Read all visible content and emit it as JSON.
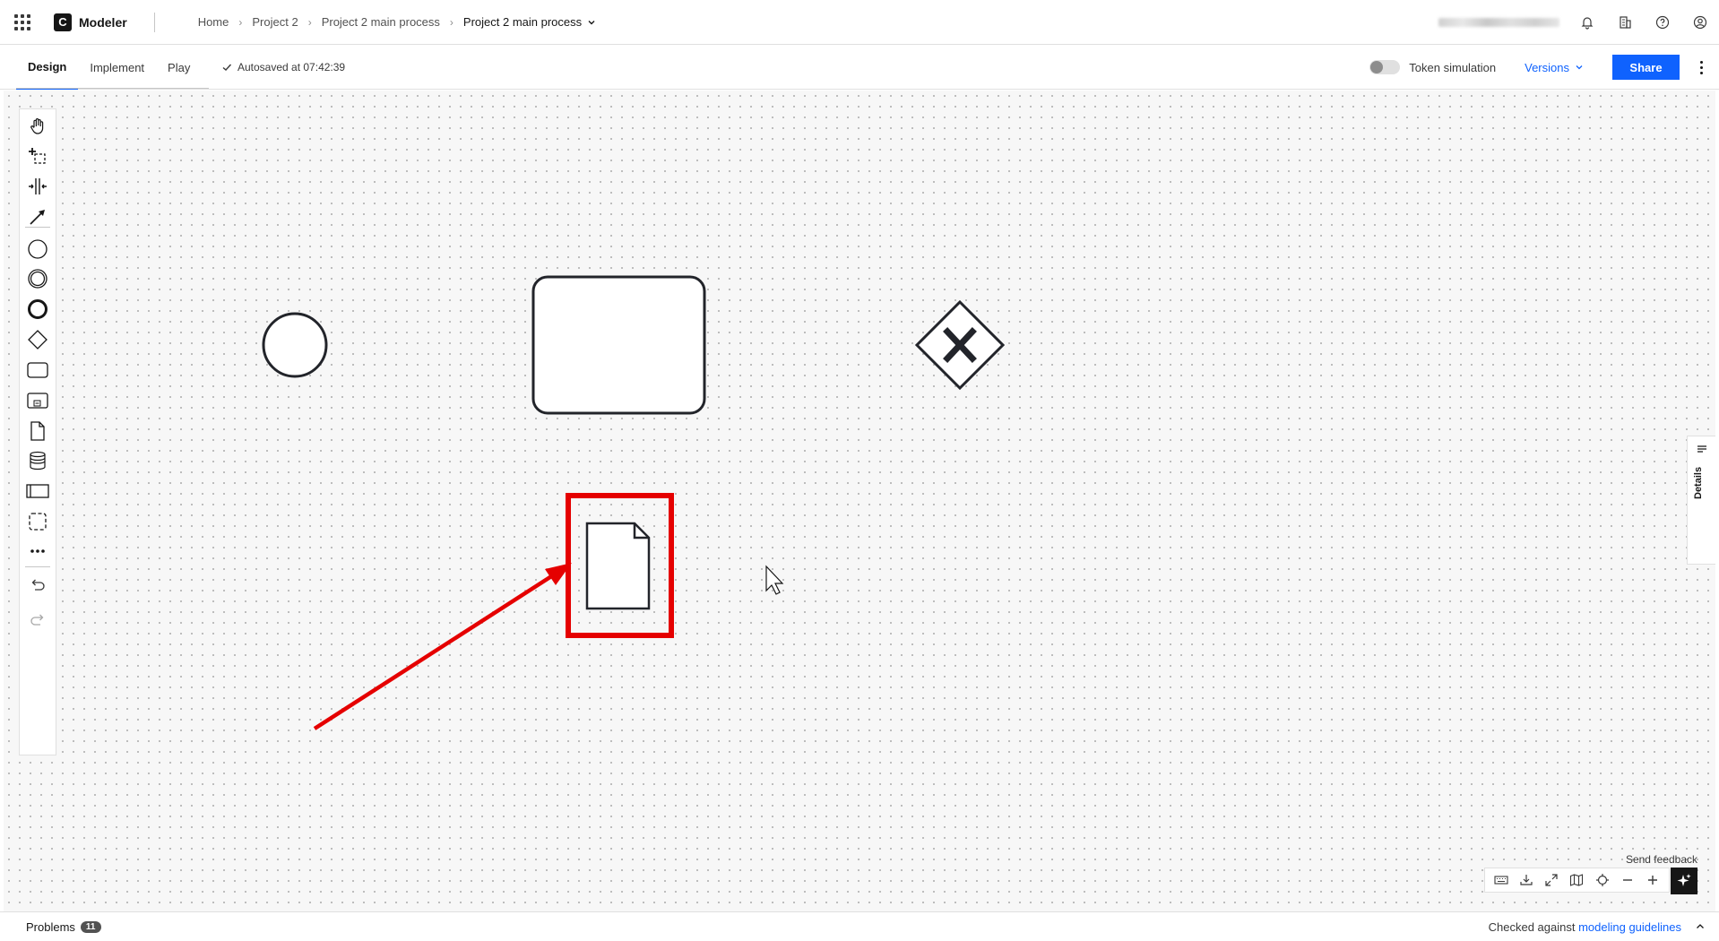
{
  "app": {
    "brand_letter": "C",
    "name": "Modeler"
  },
  "breadcrumb": {
    "items": [
      "Home",
      "Project 2",
      "Project 2 main process"
    ],
    "current": "Project 2 main process"
  },
  "tabs": [
    {
      "label": "Design",
      "active": true
    },
    {
      "label": "Implement",
      "active": false
    },
    {
      "label": "Play",
      "active": false
    }
  ],
  "autosave": "Autosaved at 07:42:39",
  "token_simulation": {
    "label": "Token simulation",
    "enabled": false
  },
  "versions_label": "Versions",
  "share_label": "Share",
  "details_label": "Details",
  "send_feedback": "Send feedback",
  "problems": {
    "label": "Problems",
    "count": "11"
  },
  "guidelines": {
    "prefix": "Checked against ",
    "link": "modeling guidelines"
  },
  "palette_icons": [
    "hand-tool-icon",
    "lasso-tool-icon",
    "space-tool-icon",
    "connect-tool-icon",
    "start-event-icon",
    "intermediate-event-icon",
    "end-event-icon",
    "gateway-icon",
    "task-icon",
    "subprocess-icon",
    "data-object-icon",
    "data-store-icon",
    "pool-icon",
    "group-icon",
    "more-icon",
    "undo-icon",
    "redo-icon"
  ],
  "colors": {
    "accent": "#0f62fe",
    "highlight": "#e50000",
    "canvas": "#f7f7f7"
  }
}
